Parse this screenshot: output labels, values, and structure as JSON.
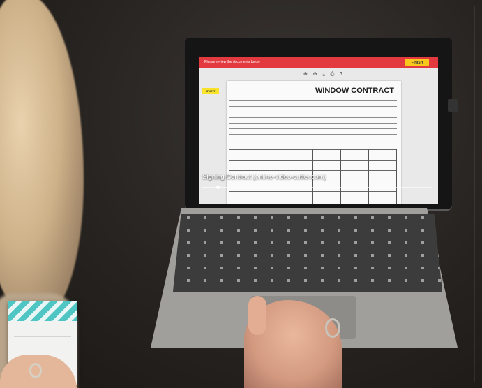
{
  "screen": {
    "banner_text": "Please review the documents below",
    "finish_label": "FINISH",
    "start_label": "START",
    "toolbar_icons": [
      "zoom-in-icon",
      "zoom-out-icon",
      "download-icon",
      "print-icon",
      "help-icon"
    ],
    "toolbar_glyphs": "⊕ ⊖ ⤓ ⎙ ?",
    "document_title": "WINDOW CONTRACT",
    "video_caption": "Signing Contract (online-video-cutter.com)"
  },
  "colors": {
    "banner": "#e23a3e",
    "finish_button": "#f8c81d",
    "start_tag": "#f8e32a"
  }
}
